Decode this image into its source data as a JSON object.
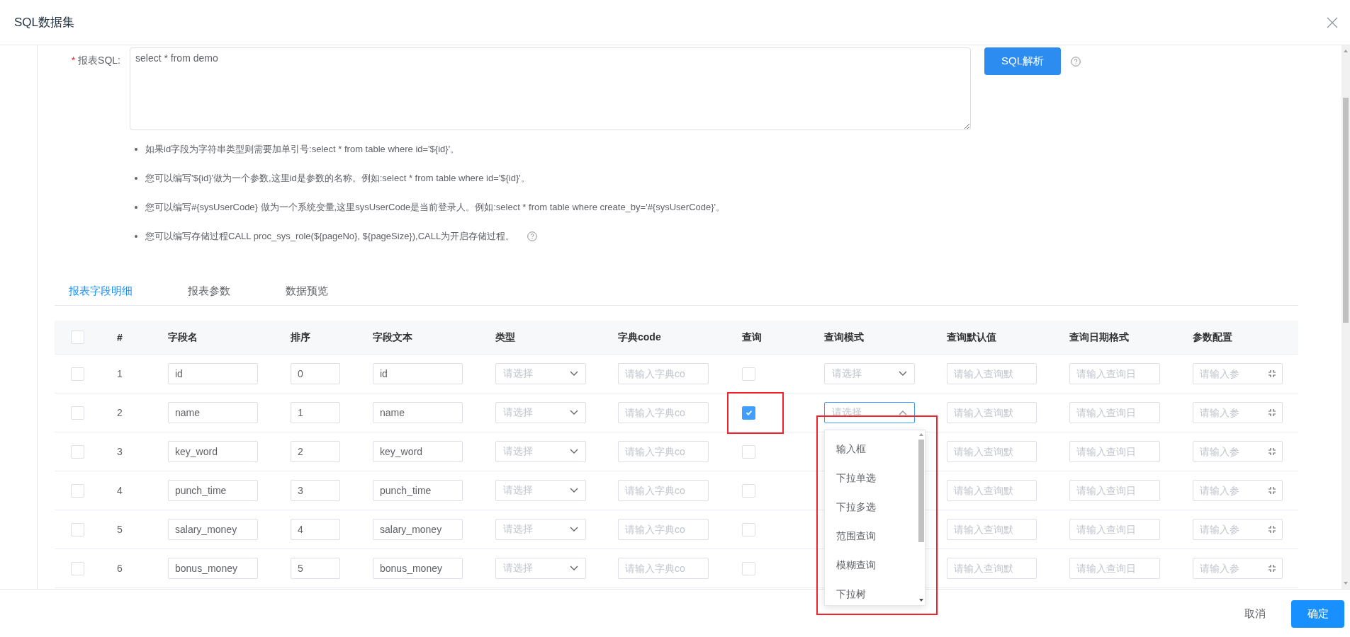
{
  "dialog": {
    "title": "SQL数据集"
  },
  "form": {
    "required_mark": "*",
    "label": "报表SQL:",
    "sql": "select * from demo",
    "parse_button": "SQL解析",
    "tips": [
      {
        "text": "如果id字段为字符串类型则需要加单引号:select * from table where id='${id}'。",
        "help_icon": false
      },
      {
        "text": "您可以编写'${id}'做为一个参数,这里id是参数的名称。例如:select * from table where id='${id}'。",
        "help_icon": false
      },
      {
        "text": "您可以编写#{sysUserCode} 做为一个系统变量,这里sysUserCode是当前登录人。例如:select * from table where create_by='#{sysUserCode}'。",
        "help_icon": false
      },
      {
        "text": "您可以编写存储过程CALL proc_sys_role(${pageNo}, ${pageSize}),CALL为开启存储过程。",
        "help_icon": true
      }
    ]
  },
  "tabs": [
    {
      "label": "报表字段明细",
      "selected": true
    },
    {
      "label": "报表参数",
      "selected": false
    },
    {
      "label": "数据预览",
      "selected": false
    }
  ],
  "table": {
    "header_checked": false,
    "columns": [
      "#",
      "字段名",
      "排序",
      "字段文本",
      "类型",
      "字典code",
      "查询",
      "查询模式",
      "查询默认值",
      "查询日期格式",
      "参数配置"
    ],
    "rows": [
      {
        "checked": false,
        "index": "1",
        "field_name": "id",
        "order": "0",
        "field_text": "id",
        "type_placeholder": "请选择",
        "dict_placeholder": "请输入字典co",
        "query": false,
        "query_mode": {
          "placeholder": "请选择",
          "open": false
        },
        "default_placeholder": "请输入查询默",
        "date_placeholder": "请输入查询日",
        "param_placeholder": "请输入参"
      },
      {
        "checked": false,
        "index": "2",
        "field_name": "name",
        "order": "1",
        "field_text": "name",
        "type_placeholder": "请选择",
        "dict_placeholder": "请输入字典co",
        "query": true,
        "query_mode": {
          "placeholder": "请选择",
          "open": true
        },
        "default_placeholder": "请输入查询默",
        "date_placeholder": "请输入查询日",
        "param_placeholder": "请输入参"
      },
      {
        "checked": false,
        "index": "3",
        "field_name": "key_word",
        "order": "2",
        "field_text": "key_word",
        "type_placeholder": "请选择",
        "dict_placeholder": "请输入字典co",
        "query": false,
        "default_placeholder": "请输入查询默",
        "date_placeholder": "请输入查询日",
        "param_placeholder": "请输入参"
      },
      {
        "checked": false,
        "index": "4",
        "field_name": "punch_time",
        "order": "3",
        "field_text": "punch_time",
        "type_placeholder": "请选择",
        "dict_placeholder": "请输入字典co",
        "query": false,
        "default_placeholder": "请输入查询默",
        "date_placeholder": "请输入查询日",
        "param_placeholder": "请输入参"
      },
      {
        "checked": false,
        "index": "5",
        "field_name": "salary_money",
        "order": "4",
        "field_text": "salary_money",
        "type_placeholder": "请选择",
        "dict_placeholder": "请输入字典co",
        "query": false,
        "default_placeholder": "请输入查询默",
        "date_placeholder": "请输入查询日",
        "param_placeholder": "请输入参"
      },
      {
        "checked": false,
        "index": "6",
        "field_name": "bonus_money",
        "order": "5",
        "field_text": "bonus_money",
        "type_placeholder": "请选择",
        "dict_placeholder": "请输入字典co",
        "query": false,
        "default_placeholder": "请输入查询默",
        "date_placeholder": "请输入查询日",
        "param_placeholder": "请输入参"
      }
    ]
  },
  "dropdown": {
    "options": [
      "输入框",
      "下拉单选",
      "下拉多选",
      "范围查询",
      "模糊查询",
      "下拉树"
    ]
  },
  "footer": {
    "cancel": "取消",
    "ok": "确定"
  }
}
